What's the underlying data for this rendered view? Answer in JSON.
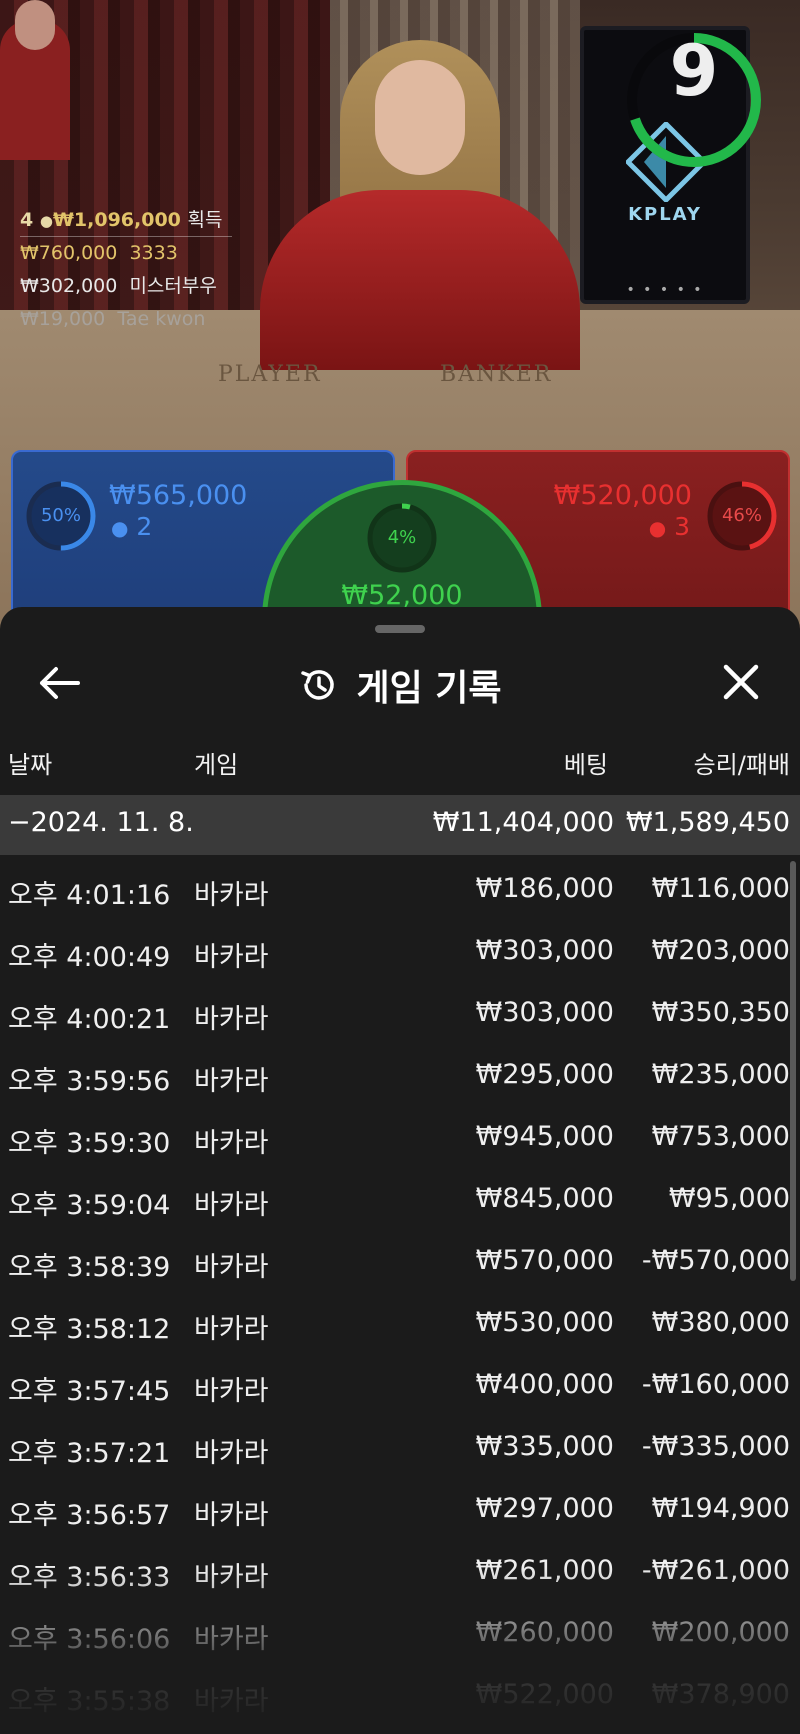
{
  "stream": {
    "brand": "KPLAY",
    "brand_dots": "• • • • •",
    "countdown": "9",
    "countdown_fraction": 0.7,
    "table_player": "PLAYER",
    "table_banker": "BANKER"
  },
  "winners": {
    "count": "4",
    "total": "₩1,096,000",
    "suffix": "획득",
    "list": [
      {
        "amount": "₩760,000",
        "name": "3333"
      },
      {
        "amount": "₩302,000",
        "name": "미스터부우"
      },
      {
        "amount": "₩19,000",
        "name": "Tae kwon"
      }
    ]
  },
  "bets": {
    "player": {
      "percent": "50%",
      "percent_value": 0.5,
      "amount": "₩565,000",
      "count": "2"
    },
    "banker": {
      "percent": "46%",
      "percent_value": 0.46,
      "amount": "₩520,000",
      "count": "3"
    },
    "tie": {
      "percent": "4%",
      "percent_value": 0.04,
      "amount": "₩52,000"
    }
  },
  "history": {
    "title": "게임 기록",
    "columns": {
      "date": "날짜",
      "game": "게임",
      "bet": "베팅",
      "result": "승리/패배"
    },
    "summary": {
      "date": "−2024. 11. 8.",
      "bet": "₩11,404,000",
      "result": "₩1,589,450"
    },
    "rows": [
      {
        "time": "오후 4:01:16",
        "game": "바카라",
        "bet": "₩186,000",
        "result": "₩116,000"
      },
      {
        "time": "오후 4:00:49",
        "game": "바카라",
        "bet": "₩303,000",
        "result": "₩203,000"
      },
      {
        "time": "오후 4:00:21",
        "game": "바카라",
        "bet": "₩303,000",
        "result": "₩350,350"
      },
      {
        "time": "오후 3:59:56",
        "game": "바카라",
        "bet": "₩295,000",
        "result": "₩235,000"
      },
      {
        "time": "오후 3:59:30",
        "game": "바카라",
        "bet": "₩945,000",
        "result": "₩753,000"
      },
      {
        "time": "오후 3:59:04",
        "game": "바카라",
        "bet": "₩845,000",
        "result": "₩95,000"
      },
      {
        "time": "오후 3:58:39",
        "game": "바카라",
        "bet": "₩570,000",
        "result": "-₩570,000"
      },
      {
        "time": "오후 3:58:12",
        "game": "바카라",
        "bet": "₩530,000",
        "result": "₩380,000"
      },
      {
        "time": "오후 3:57:45",
        "game": "바카라",
        "bet": "₩400,000",
        "result": "-₩160,000"
      },
      {
        "time": "오후 3:57:21",
        "game": "바카라",
        "bet": "₩335,000",
        "result": "-₩335,000"
      },
      {
        "time": "오후 3:56:57",
        "game": "바카라",
        "bet": "₩297,000",
        "result": "₩194,900"
      },
      {
        "time": "오후 3:56:33",
        "game": "바카라",
        "bet": "₩261,000",
        "result": "-₩261,000"
      },
      {
        "time": "오후 3:56:06",
        "game": "바카라",
        "bet": "₩260,000",
        "result": "₩200,000"
      },
      {
        "time": "오후 3:55:38",
        "game": "바카라",
        "bet": "₩522,000",
        "result": "₩378,900"
      }
    ]
  },
  "colors": {
    "player_blue": "#3a78d8",
    "banker_red": "#e02a2a",
    "tie_green": "#3fd24e",
    "gold": "#e2c46a",
    "sheet_bg": "#1b1b1b"
  }
}
